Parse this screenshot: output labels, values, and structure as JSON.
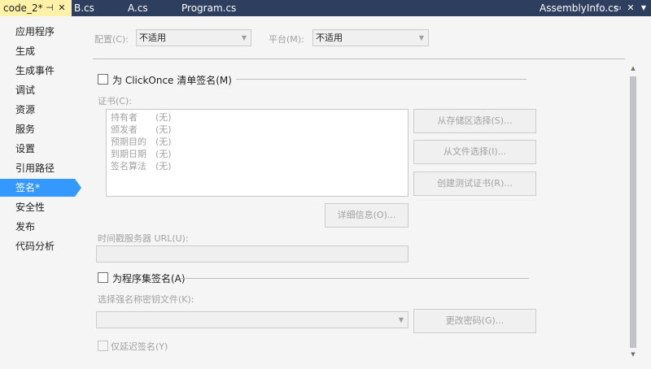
{
  "tabs": {
    "active": {
      "label": "code_2*",
      "pin_icon": "pin-icon",
      "close_icon": "close-icon"
    },
    "others": [
      {
        "label": "B.cs"
      },
      {
        "label": "A.cs"
      },
      {
        "label": "Program.cs"
      }
    ],
    "right_file": "AssemblyInfo.cs",
    "right_pin": "pin-icon",
    "right_close": "close-icon"
  },
  "sidebar": {
    "items": [
      {
        "label": "应用程序"
      },
      {
        "label": "生成"
      },
      {
        "label": "生成事件"
      },
      {
        "label": "调试"
      },
      {
        "label": "资源"
      },
      {
        "label": "服务"
      },
      {
        "label": "设置"
      },
      {
        "label": "引用路径"
      },
      {
        "label": "签名*",
        "selected": true
      },
      {
        "label": "安全性"
      },
      {
        "label": "发布"
      },
      {
        "label": "代码分析"
      }
    ]
  },
  "config": {
    "config_label": "配置(C):",
    "config_value": "不适用",
    "platform_label": "平台(M):",
    "platform_value": "不适用"
  },
  "clickonce": {
    "checkbox_label": "为 ClickOnce 清单签名(M)",
    "checked": false,
    "cert_label": "证书(C):",
    "cert_rows": [
      {
        "key": "持有者",
        "value": "(无)"
      },
      {
        "key": "颁发者",
        "value": "(无)"
      },
      {
        "key": "预期目的",
        "value": "(无)"
      },
      {
        "key": "到期日期",
        "value": "(无)"
      },
      {
        "key": "签名算法",
        "value": "(无)"
      }
    ],
    "btn_store": "从存储区选择(S)...",
    "btn_file": "从文件选择(I)...",
    "btn_test": "创建测试证书(R)...",
    "btn_details": "详细信息(O)...",
    "timestamp_label": "时间戳服务器 URL(U):",
    "timestamp_value": ""
  },
  "assembly": {
    "checkbox_label": "为程序集签名(A)",
    "checked": false,
    "keyfile_label": "选择强名称密钥文件(K):",
    "keyfile_value": "",
    "btn_change_pwd": "更改密码(G)...",
    "delay_label": "仅延迟签名(Y)",
    "delay_checked": false
  },
  "colors": {
    "tabbar_bg": "#2d3e5e",
    "active_tab_bg": "#fff1a8",
    "selected_item_bg": "#3399ff",
    "disabled_text": "#a2a2a2"
  }
}
